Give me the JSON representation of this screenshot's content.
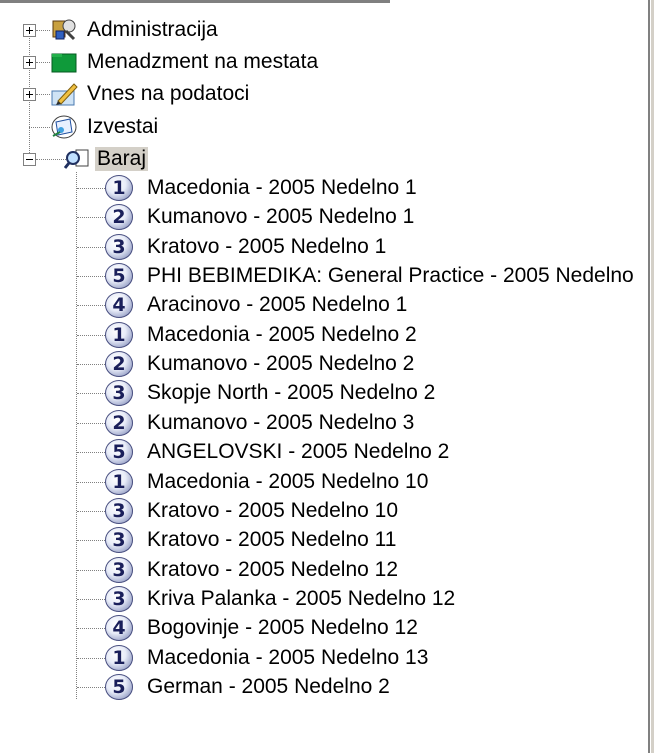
{
  "tree": {
    "top_level": [
      {
        "label": "Administracija",
        "icon": "admin-tools-icon",
        "expander": "plus"
      },
      {
        "label": "Menadzment na mestata",
        "icon": "green-folder-icon",
        "expander": "plus"
      },
      {
        "label": "Vnes na podatoci",
        "icon": "data-entry-pen-icon",
        "expander": "plus"
      },
      {
        "label": "Izvestai",
        "icon": "reports-icon",
        "expander": null
      },
      {
        "label": "Baraj",
        "icon": "search-find-icon",
        "expander": "minus",
        "selected": true
      }
    ],
    "children": [
      {
        "badge": "1",
        "label": "Macedonia - 2005 Nedelno 1"
      },
      {
        "badge": "2",
        "label": "Kumanovo - 2005 Nedelno 1"
      },
      {
        "badge": "3",
        "label": "Kratovo - 2005 Nedelno 1"
      },
      {
        "badge": "5",
        "label": "PHI BEBIMEDIKA: General Practice - 2005 Nedelno"
      },
      {
        "badge": "4",
        "label": "Aracinovo - 2005 Nedelno 1"
      },
      {
        "badge": "1",
        "label": "Macedonia - 2005 Nedelno 2"
      },
      {
        "badge": "2",
        "label": "Kumanovo - 2005 Nedelno 2"
      },
      {
        "badge": "3",
        "label": "Skopje North - 2005 Nedelno 2"
      },
      {
        "badge": "2",
        "label": "Kumanovo - 2005 Nedelno 3"
      },
      {
        "badge": "5",
        "label": "ANGELOVSKI - 2005 Nedelno 2"
      },
      {
        "badge": "1",
        "label": "Macedonia - 2005 Nedelno 10"
      },
      {
        "badge": "3",
        "label": "Kratovo - 2005 Nedelno 10"
      },
      {
        "badge": "3",
        "label": "Kratovo - 2005 Nedelno 11"
      },
      {
        "badge": "3",
        "label": "Kratovo - 2005 Nedelno 12"
      },
      {
        "badge": "3",
        "label": "Kriva Palanka - 2005 Nedelno 12"
      },
      {
        "badge": "4",
        "label": "Bogovinje - 2005 Nedelno 12"
      },
      {
        "badge": "1",
        "label": "Macedonia - 2005 Nedelno 13"
      },
      {
        "badge": "5",
        "label": "German - 2005 Nedelno 2"
      }
    ]
  },
  "colors": {
    "selection_bg": "#d4d0c8",
    "tree_line": "#808080",
    "badge_text": "#1a1f5a"
  }
}
